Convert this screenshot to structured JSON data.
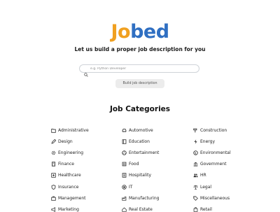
{
  "logo": {
    "part1": "Jo",
    "part2": "bed"
  },
  "tagline": "Let us build a proper job description for you",
  "search": {
    "placeholder": "e.g. Python Developer"
  },
  "build_button": "Build job description",
  "section_title": "Job Categories",
  "categories": [
    "Administrative",
    "Automotive",
    "Construction",
    "Design",
    "Education",
    "Energy",
    "Engineering",
    "Entertainment",
    "Environmental",
    "Finance",
    "Food",
    "Government",
    "Healthcare",
    "Hospitality",
    "HR",
    "Insurance",
    "IT",
    "Legal",
    "Management",
    "Manufacturing",
    "Miscellaneous",
    "Marketing",
    "Real Estate",
    "Retail"
  ],
  "colors": {
    "logo_orange": "#f0a020",
    "logo_blue": "#2f6fc2"
  }
}
